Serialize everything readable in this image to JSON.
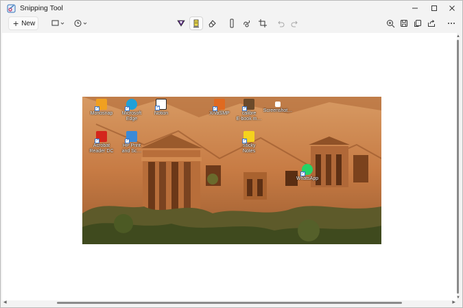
{
  "app": {
    "title": "Snipping Tool",
    "icon": "snipping-tool-icon"
  },
  "window_controls": {
    "minimize": "minimize-icon",
    "maximize": "maximize-icon",
    "close": "close-icon"
  },
  "toolbar": {
    "new_label": "New",
    "snip_mode": "rectangle-icon",
    "delay": "clock-icon",
    "tools": [
      "ballpoint-pen-icon",
      "highlighter-icon",
      "eraser-icon",
      "ruler-icon",
      "touch-writing-icon",
      "crop-icon",
      "undo-icon",
      "redo-icon"
    ],
    "active_tool": "highlighter-icon",
    "right_tools": [
      "zoom-in-icon",
      "save-icon",
      "copy-icon",
      "share-icon",
      "more-icon"
    ],
    "colors": {
      "pen": "#5b2a86",
      "highlighter": "#f3e04a"
    }
  },
  "snip": {
    "desktop_icons": [
      {
        "label": "Monosnap",
        "color": "#f0a020"
      },
      {
        "label": "Microsoft\nEdge",
        "color": "#1fa0d8"
      },
      {
        "label": "Notion",
        "color": "#ffffff"
      },
      {
        "label": "XiVaSMP",
        "color": "#e06a20"
      },
      {
        "label": "calibre\nE-book m…",
        "color": "#6b4a2a"
      },
      {
        "label": "Screenshot…",
        "color": "#ffffff"
      },
      {
        "label": "Acrobat\nReader DC",
        "color": "#d4261c"
      },
      {
        "label": "HP Print\nand Sc…",
        "color": "#3a8ad8"
      },
      {
        "label": "Sticky\nNotes",
        "color": "#f5d21e"
      },
      {
        "label": "WhatsApp",
        "color": "#25d366"
      }
    ]
  }
}
